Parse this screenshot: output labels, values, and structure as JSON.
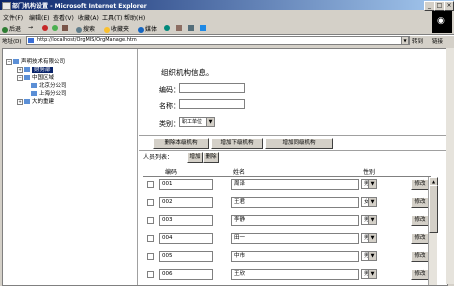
{
  "window": {
    "title": "部门机构设置 - Microsoft Internet Explorer",
    "min": "_",
    "max": "□",
    "close": "×"
  },
  "menu": [
    "文件(F)",
    "编辑(E)",
    "查看(V)",
    "收藏(A)",
    "工具(T)",
    "帮助(H)"
  ],
  "toolbar": {
    "back": "后退",
    "forward": "→",
    "search": "搜索",
    "favorites": "收藏夹",
    "media": "媒体"
  },
  "address": {
    "label": "地址(D)",
    "url": "http://localhost/OrgMIS/OrgManage.htm",
    "go": "转到",
    "links": "链接"
  },
  "tree": {
    "root": "声明技术有限公司",
    "items": [
      "财务部",
      "中国区域",
      "北京分公司",
      "上海分公司",
      "大的重建"
    ]
  },
  "form": {
    "heading": "组织机构信息。",
    "code_label": "编码：",
    "name_label": "名称：",
    "type_label": "类别：",
    "type_value": "职工单位"
  },
  "actions": {
    "delete_org": "删除本级机构",
    "add_sub": "增加下级机构",
    "add_peer": "增加同级机构"
  },
  "subtabs": {
    "title": "人员列表：",
    "add": "增加",
    "delete": "删除"
  },
  "table": {
    "headers": [
      "编码",
      "姓名",
      "性别"
    ],
    "rows": [
      {
        "code": "001",
        "name": "周泽",
        "gender": "男",
        "edit": "修改"
      },
      {
        "code": "002",
        "name": "王君",
        "gender": "女",
        "edit": "修改"
      },
      {
        "code": "003",
        "name": "李静",
        "gender": "男",
        "edit": "修改"
      },
      {
        "code": "004",
        "name": "田一",
        "gender": "男",
        "edit": "修改"
      },
      {
        "code": "005",
        "name": "中市",
        "gender": "男",
        "edit": "修改"
      },
      {
        "code": "006",
        "name": "王欣",
        "gender": "男",
        "edit": "修改"
      }
    ]
  },
  "colors": {
    "titlebar": "#0a246a",
    "face": "#d4d0c8"
  }
}
